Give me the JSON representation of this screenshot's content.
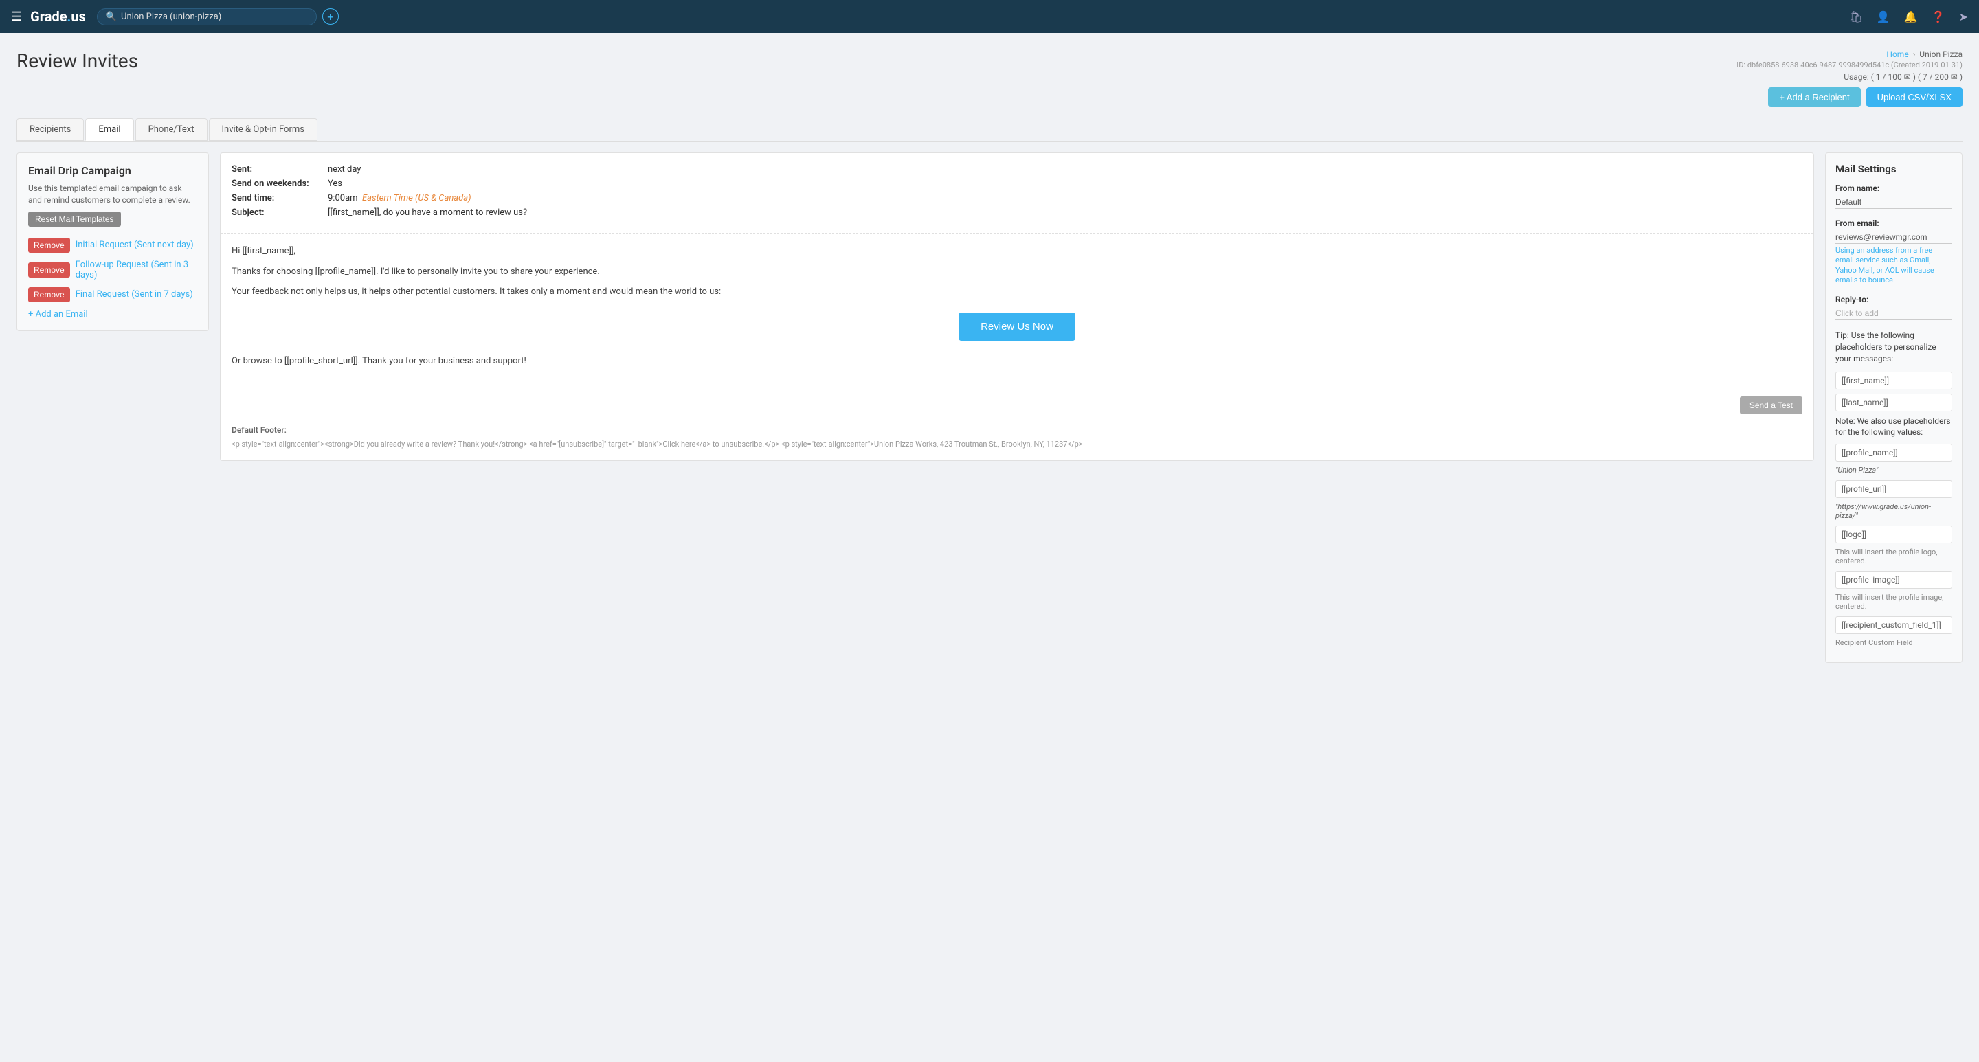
{
  "topnav": {
    "logo": "Grade.us",
    "search_placeholder": "Union Pizza (union-pizza)",
    "icons": [
      "bag-icon",
      "user-icon",
      "bell-icon",
      "help-icon",
      "logout-icon"
    ]
  },
  "breadcrumb": {
    "home": "Home",
    "location": "Union Pizza"
  },
  "page": {
    "title": "Review Invites",
    "id": "ID: dbfe0858-6938-40c6-9487-9998499d541c (Created 2019-01-31)",
    "usage": "Usage: ( 1 / 100 ✉ ) ( 7 / 200 ✉ )"
  },
  "action_buttons": {
    "add_recipient": "+ Add a Recipient",
    "upload_csv": "Upload CSV/XLSX"
  },
  "tabs": [
    {
      "label": "Recipients",
      "active": false
    },
    {
      "label": "Email",
      "active": true
    },
    {
      "label": "Phone/Text",
      "active": false
    },
    {
      "label": "Invite & Opt-in Forms",
      "active": false
    }
  ],
  "left_panel": {
    "title": "Email Drip Campaign",
    "description": "Use this templated email campaign to ask and remind customers to complete a review.",
    "reset_button": "Reset Mail Templates",
    "emails": [
      {
        "label": "Initial Request (Sent next day)"
      },
      {
        "label": "Follow-up Request (Sent in 3 days)"
      },
      {
        "label": "Final Request (Sent in 7 days)"
      }
    ],
    "add_email": "+ Add an Email",
    "remove_label": "Remove"
  },
  "email_preview": {
    "sent_label": "Sent:",
    "sent_value": "next day",
    "weekends_label": "Send on weekends:",
    "weekends_value": "Yes",
    "time_label": "Send time:",
    "time_value": "9:00am",
    "timezone": "Eastern Time (US & Canada)",
    "subject_label": "Subject:",
    "subject_value": "[[first_name]], do you have a moment to review us?",
    "body_greeting": "Hi [[first_name]],",
    "body_paragraph1": "Thanks for choosing [[profile_name]]. I'd like to personally invite you to share your experience.",
    "body_paragraph2": "Your feedback not only helps us, it helps other potential customers. It takes only a moment and would mean the world to us:",
    "review_button": "Review Us Now",
    "body_paragraph3": "Or browse to [[profile_short_url]]. Thank you for your business and support!",
    "send_test_button": "Send a Test",
    "default_footer_label": "Default Footer:",
    "footer_html": "<p style=\"text-align:center\"><strong>Did you already write a review? Thank you!</strong> <a href=\"[unsubscribe]\" target=\"_blank\">Click here</a> to unsubscribe.</p> <p style=\"text-align:center\">Union Pizza Works, 423 Troutman St., Brooklyn, NY, 11237</p>"
  },
  "mail_settings": {
    "title": "Mail Settings",
    "from_name_label": "From name:",
    "from_name_value": "Default",
    "from_email_label": "From email:",
    "from_email_value": "reviews@reviewmgr.com",
    "from_email_note": "Using an address from a free email service such as Gmail, Yahoo Mail, or AOL will cause emails to bounce.",
    "reply_to_label": "Reply-to:",
    "reply_to_placeholder": "Click to add",
    "tip_text": "Tip: Use the following placeholders to personalize your messages:",
    "placeholder_first_name": "[[first_name]]",
    "placeholder_last_name": "[[last_name]]",
    "note_text": "Note: We also use placeholders for the following values:",
    "placeholders": [
      {
        "tag": "[[profile_name]]",
        "note": "\"Union Pizza\""
      },
      {
        "tag": "[[profile_url]]",
        "note": "\"https://www.grade.us/union-pizza/\""
      },
      {
        "tag": "[[logo]]",
        "note": "This will insert the profile logo, centered."
      },
      {
        "tag": "[[profile_image]]",
        "note": "This will insert the profile image, centered."
      },
      {
        "tag": "[[recipient_custom_field_1]]",
        "note": "Recipient Custom Field"
      }
    ]
  }
}
